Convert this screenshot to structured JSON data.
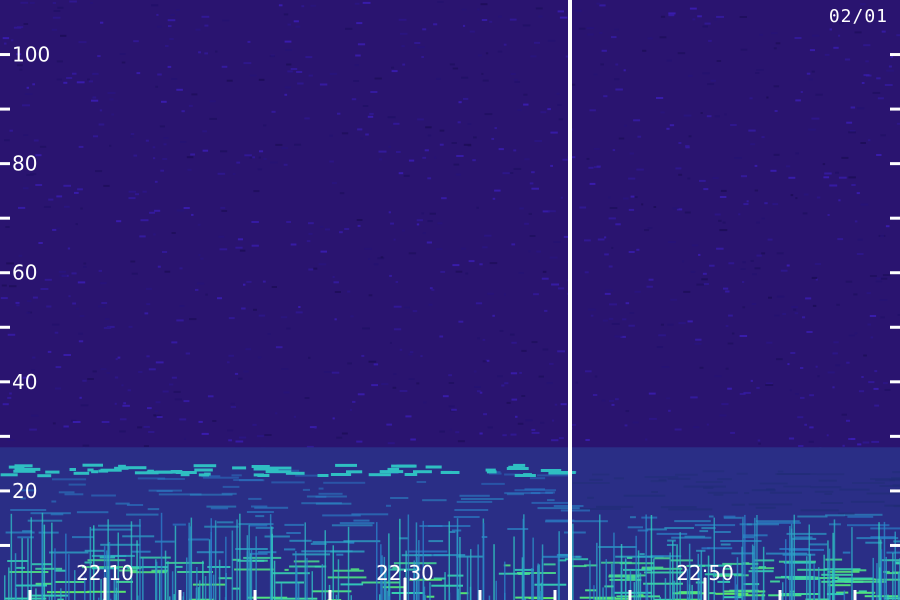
{
  "chart_data": {
    "type": "heatmap",
    "title": "",
    "xlabel": "",
    "ylabel": "",
    "date": "02/01",
    "y_tick_labels": [
      "20",
      "40",
      "60",
      "80",
      "100"
    ],
    "y_range": [
      0,
      110
    ],
    "y_major_ticks": [
      20,
      40,
      60,
      80,
      100
    ],
    "y_minor_ticks": [
      10,
      30,
      50,
      70,
      90
    ],
    "x_tick_labels": [
      "22:10",
      "22:30",
      "22:50"
    ],
    "x_time_range": [
      "22:03",
      "23:03"
    ],
    "x_major_ticks": [
      "22:10",
      "22:30",
      "22:50"
    ],
    "x_minor_ticks": [
      "22:05",
      "22:15",
      "22:20",
      "22:25",
      "22:35",
      "22:40",
      "22:45",
      "22:55",
      "23:00"
    ],
    "separator_time": "22:41",
    "grid": false,
    "colors": {
      "background": "#2a1470",
      "noise_low": "#1a0c52",
      "noise_high": "#4020c8",
      "band_mid": "#2a7ac8",
      "band_high": "#30d0c0",
      "band_peak": "#60f060",
      "tick": "#ffffff",
      "label": "#ffffff"
    }
  }
}
